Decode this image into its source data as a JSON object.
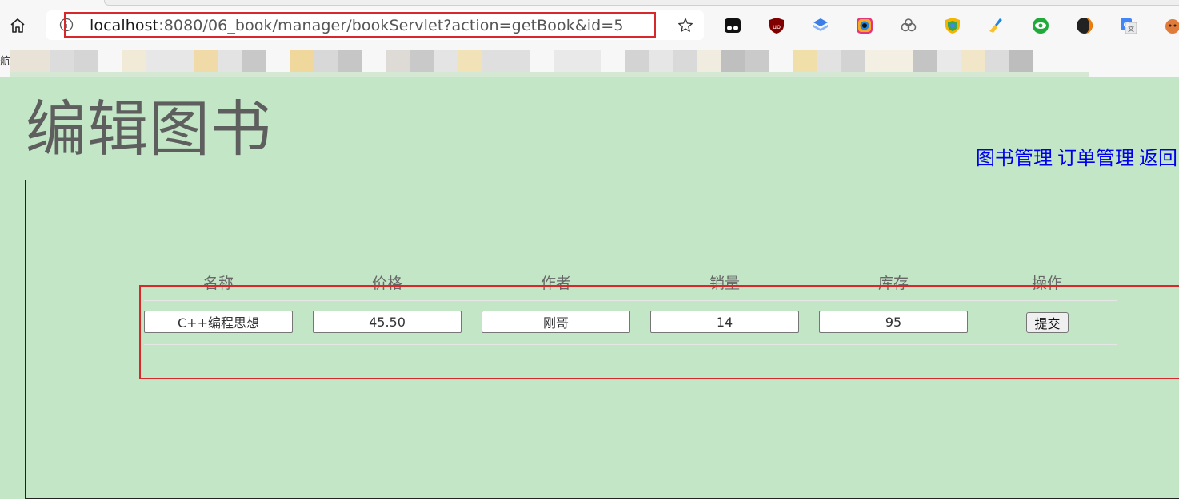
{
  "browser": {
    "url_host": "localhost",
    "url_rest": ":8080/06_book/manager/bookServlet?action=getBook&id=5",
    "bookmark_first": "航"
  },
  "page": {
    "title": "编辑图书",
    "nav": [
      "图书管理",
      "订单管理",
      "返回"
    ]
  },
  "table": {
    "headers": [
      "名称",
      "价格",
      "作者",
      "销量",
      "库存",
      "操作"
    ],
    "row": {
      "name": "C++编程思想",
      "price": "45.50",
      "author": "刚哥",
      "sales": "14",
      "stock": "95"
    },
    "submit_label": "提交"
  },
  "colors": {
    "page_bg": "#c3e6c6",
    "highlight": "#d8282c",
    "link": "#0000ee"
  }
}
